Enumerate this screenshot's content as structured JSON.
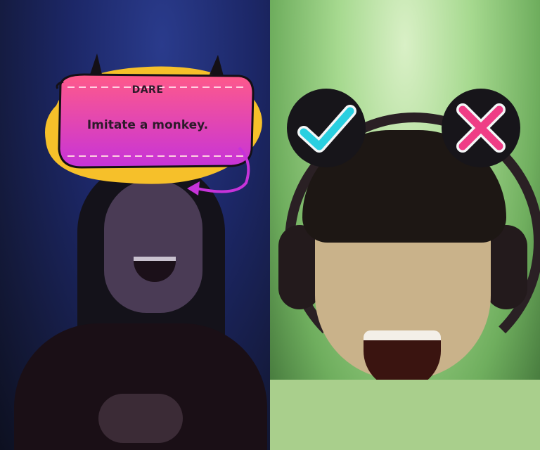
{
  "dare_card": {
    "label": "DARE",
    "prompt": "Imitate a monkey."
  },
  "actions": {
    "accept_icon": "checkmark-icon",
    "decline_icon": "x-icon"
  },
  "colors": {
    "card_gradient_top": "#ff5a8a",
    "card_gradient_bottom": "#c633d9",
    "card_accent_yellow": "#f6c02a",
    "accept_accent": "#29cfe0",
    "decline_accent": "#ef3d86",
    "button_bg": "#17151a"
  }
}
